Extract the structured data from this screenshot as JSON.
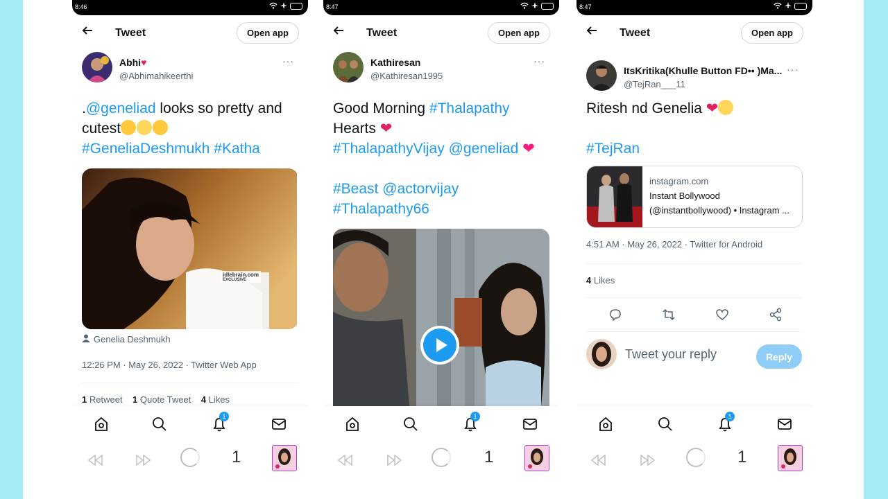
{
  "phones": [
    {
      "status_time": "8:46",
      "header_title": "Tweet",
      "open_app_label": "Open app",
      "author_name": "Abhi",
      "author_name_suffix": "♥",
      "author_handle": "@Abhimahikeerthi",
      "more_label": "···",
      "text_mention": "@geneliad",
      "text_part1": " looks so pretty and",
      "text_part2": "cutest",
      "hashtag1": "#GeneliaDeshmukh",
      "hashtag2": "#Katha",
      "image_watermark": "idlebrain.com",
      "image_watermark_sub": "EXCLUSIVE",
      "tagged_user": "Genelia Deshmukh",
      "timestamp": "12:26 PM · May 26, 2022 · Twitter Web App",
      "retweets_count": "1",
      "retweets_label": "Retweet",
      "quotes_count": "1",
      "quotes_label": "Quote Tweet",
      "likes_count": "4",
      "likes_label": "Likes",
      "notif_badge": "1",
      "tab_count": "1"
    },
    {
      "status_time": "8:47",
      "header_title": "Tweet",
      "open_app_label": "Open app",
      "author_name": "Kathiresan",
      "author_handle": "@Kathiresan1995",
      "more_label": "···",
      "line1_text": "Good Morning ",
      "line1_tag": "#Thalapathy",
      "line2_text": "Hearts",
      "line3_tag": "#ThalapathyVijay",
      "line3_mention": "@geneliad",
      "line4_tag": "#Beast",
      "line4_mention": "@actorvijay",
      "line5_tag": "#Thalapathy66",
      "notif_badge": "1",
      "tab_count": "1"
    },
    {
      "status_time": "8:47",
      "header_title": "Tweet",
      "open_app_label": "Open app",
      "author_name": "ItsKritika(Khulle Button FD•• )Ma...",
      "author_handle": "@TejRan___11",
      "more_label": "···",
      "text_main": "Ritesh nd Genelia",
      "hashtag": "#TejRan",
      "card_domain": "instagram.com",
      "card_title": "Instant Bollywood",
      "card_subtitle": "(@instantbollywood) • Instagram ...",
      "timestamp": "4:51 AM · May 26, 2022 · Twitter for Android",
      "likes_count": "4",
      "likes_label": "Likes",
      "reply_placeholder": "Tweet your reply",
      "reply_button": "Reply",
      "notif_badge": "1",
      "tab_count": "1"
    }
  ],
  "colors": {
    "accent": "#1d9bf0",
    "side_panel": "#a6ecf7",
    "heart": "#e0245e",
    "reply_button": "#8ecdf8"
  },
  "icons": [
    "back-arrow-icon",
    "home-icon",
    "search-icon",
    "bell-icon",
    "mail-icon",
    "rewind-icon",
    "forward-icon",
    "reload-icon",
    "reply-icon",
    "retweet-icon",
    "like-icon",
    "share-icon",
    "person-icon",
    "play-icon",
    "wifi-icon",
    "airplane-icon",
    "battery-icon"
  ]
}
